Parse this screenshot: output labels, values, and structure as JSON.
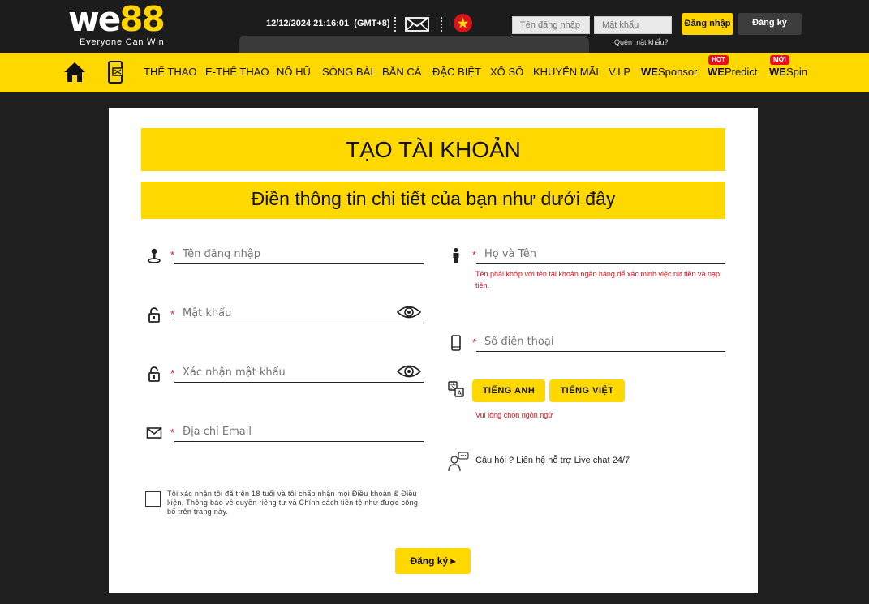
{
  "header": {
    "logo_text": "we",
    "logo_number": "88",
    "logo_tagline": "Everyone Can Win",
    "datetime": "12/12/2024 21:16:01",
    "timezone": "(GMT+8)",
    "username_placeholder": "Tên đăng nhập",
    "password_placeholder": "Mật khẩu",
    "forgot_password": "Quên mật khẩu?",
    "login_button": "Đăng nhập",
    "register_button": "Đăng ký",
    "language_flag": "vietnam-flag-icon"
  },
  "nav": {
    "items": [
      {
        "label": "THỂ THAO"
      },
      {
        "label": "E-THỂ THAO"
      },
      {
        "label": "NỔ HŨ"
      },
      {
        "label": "SÒNG BÀI"
      },
      {
        "label": "BẮN CÁ"
      },
      {
        "label": "ĐẶC BIỆT"
      },
      {
        "label": "XỔ SỐ"
      },
      {
        "label": "KHUYẾN MÃI"
      },
      {
        "label": "V.I.P"
      }
    ],
    "wesponsor": {
      "bold": "WE",
      "rest": "Sponsor"
    },
    "wepredict": {
      "bold": "WE",
      "rest": "Predict",
      "badge": "HOT"
    },
    "wespin": {
      "bold": "WE",
      "rest": "Spin",
      "badge": "MỚI"
    }
  },
  "form": {
    "title": "TẠO TÀI KHOẢN",
    "subtitle": "Điền thông tin chi tiết của bạn như dưới đây",
    "required_mark": "*",
    "username_placeholder": "Tên đăng nhập",
    "password_placeholder": "Mật khẩu",
    "confirm_password_placeholder": "Xác nhận mật khẩu",
    "email_placeholder": "Địa chỉ Email",
    "fullname_placeholder": "Họ và Tên",
    "fullname_hint": "Tên phải khớp với tên tài khoản ngân hàng để xác minh việc rút tiền và nạp tiền.",
    "phone_placeholder": "Số điện thoại",
    "lang_english": "TIẾNG ANH",
    "lang_vietnamese": "TIẾNG VIỆT",
    "lang_hint": "Vui lòng chọn ngôn ngữ",
    "livechat": "Câu hỏi ? Liên hệ hỗ trợ Live chat 24/7",
    "terms": "Tôi xác nhận tôi đã trên 18 tuổi và tôi chấp nhận mọi Điều khoản & Điều kiện, Thông báo về quyền riêng tư và Chính sách tiền tệ như được công bố trên trang này.",
    "submit": "Đăng ký",
    "submit_arrow": "▸"
  },
  "colors": {
    "accent": "#ffd800",
    "topbar": "#1c1c1c",
    "error": "#d8121c"
  }
}
